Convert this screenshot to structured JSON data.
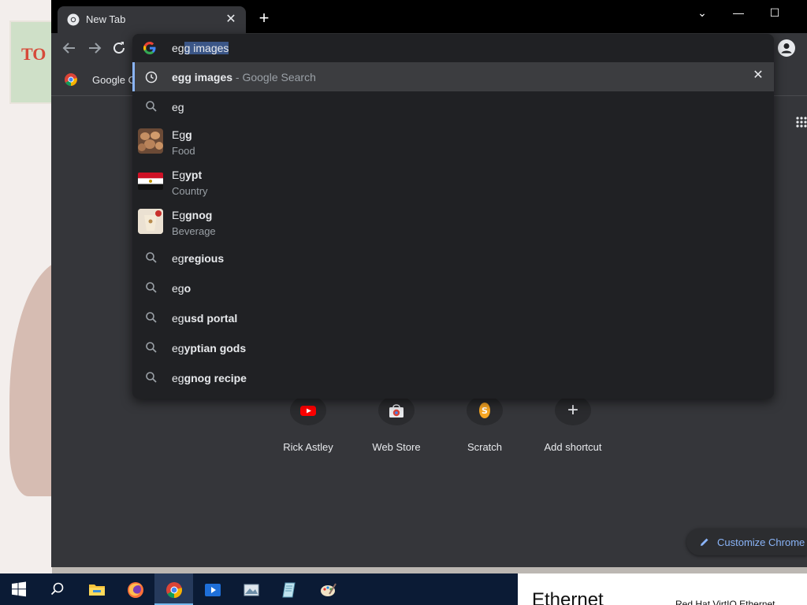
{
  "wallpaper": {
    "poster_text": "TO"
  },
  "browser": {
    "tab": {
      "title": "New Tab",
      "close_glyph": "✕"
    },
    "new_tab_glyph": "+",
    "window_controls": {
      "dropdown": "⌄",
      "minimize": "—",
      "maximize": "☐",
      "close": "✕"
    },
    "bookmark": {
      "label": "Google C"
    }
  },
  "omnibox": {
    "input": {
      "typed": "eg",
      "autocomplete_selected": "g images"
    },
    "suggestions": [
      {
        "type": "history",
        "icon": "clock-icon",
        "prefix": "egg images",
        "bold": "",
        "suffix": " - Google Search",
        "selected": true
      },
      {
        "type": "search",
        "icon": "search-icon",
        "prefix": "eg",
        "bold": ""
      },
      {
        "type": "entity",
        "thumb": "egg-thumbnail",
        "prefix": "Eg",
        "bold": "g",
        "subtitle": "Food"
      },
      {
        "type": "entity",
        "thumb": "egypt-flag",
        "prefix": "Eg",
        "bold": "ypt",
        "subtitle": "Country"
      },
      {
        "type": "entity",
        "thumb": "eggnog-thumbnail",
        "prefix": "Eg",
        "bold": "gnog",
        "subtitle": "Beverage"
      },
      {
        "type": "search",
        "icon": "search-icon",
        "prefix": "eg",
        "bold": "regious"
      },
      {
        "type": "search",
        "icon": "search-icon",
        "prefix": "eg",
        "bold": "o"
      },
      {
        "type": "search",
        "icon": "search-icon",
        "prefix": "eg",
        "bold": "usd portal"
      },
      {
        "type": "search",
        "icon": "search-icon",
        "prefix": "eg",
        "bold": "yptian gods"
      },
      {
        "type": "search",
        "icon": "search-icon",
        "prefix": "eg",
        "bold": "gnog recipe"
      }
    ],
    "remove_glyph": "✕"
  },
  "shortcuts": [
    {
      "label": "Rick Astley",
      "icon": "youtube-icon"
    },
    {
      "label": "Web Store",
      "icon": "webstore-icon"
    },
    {
      "label": "Scratch",
      "icon": "scratch-icon"
    },
    {
      "label": "Add shortcut",
      "icon": "plus-icon",
      "glyph": "+"
    }
  ],
  "customize": {
    "label": "Customize Chrome"
  },
  "taskbar": {
    "items": [
      "windows-start-icon",
      "search-icon",
      "file-explorer-icon",
      "firefox-icon",
      "chrome-icon",
      "media-player-icon",
      "image-viewer-icon",
      "notepad-icon",
      "paint-icon"
    ],
    "network_panel": {
      "title": "Ethernet",
      "subtitle": "Red Hat VirtIO Ethernet"
    }
  },
  "colors": {
    "accent": "#8ab4f8",
    "surface": "#35363a",
    "dropdown": "#202124",
    "taskbar": "#0b1b35"
  }
}
